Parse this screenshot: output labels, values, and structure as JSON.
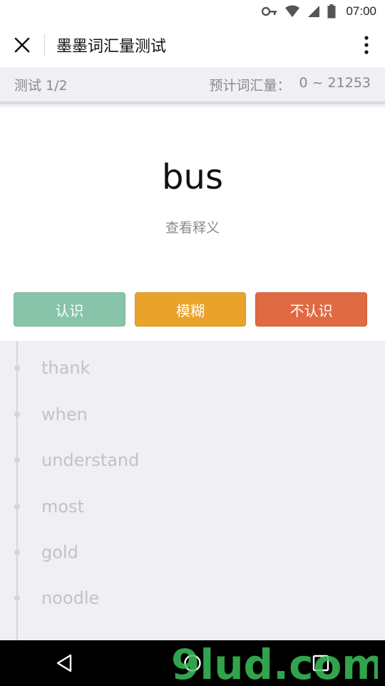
{
  "status": {
    "time": "07:00",
    "battery_label": "100"
  },
  "appbar": {
    "title": "墨墨词汇量测试"
  },
  "progress": {
    "text": "测试 1/2"
  },
  "estimate": {
    "label": "预计词汇量：",
    "value": "0 ~ 21253"
  },
  "card": {
    "word": "bus",
    "meaning_link": "查看释义",
    "actions": {
      "know": "认识",
      "vague": "模糊",
      "unknown": "不认识"
    }
  },
  "history": {
    "words": [
      "thank",
      "when",
      "understand",
      "most",
      "gold",
      "noodle"
    ]
  },
  "watermark": {
    "text": "9lud.com"
  },
  "colors": {
    "know": "#87c4a9",
    "vague": "#e9a22b",
    "unknown": "#e06a41"
  }
}
